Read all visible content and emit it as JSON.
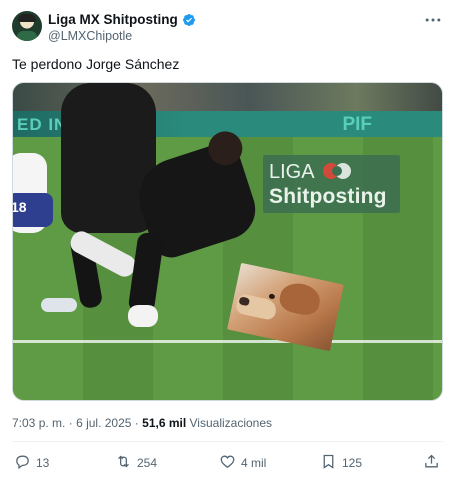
{
  "author": {
    "display_name": "Liga MX Shitposting",
    "handle": "@LMXChipotle",
    "verified": true
  },
  "tweet": {
    "text": "Te perdono Jorge Sánchez"
  },
  "media": {
    "board_text_left": "ED IN ER",
    "board_text_right": "PIF",
    "player_number": "18",
    "logo_line1": "LIGA",
    "logo_line2": "Shitposting"
  },
  "meta": {
    "time": "7:03 p. m.",
    "separator": "·",
    "date": "6 jul. 2025",
    "separator2": "·",
    "views_count": "51,6 mil",
    "views_label": "Visualizaciones"
  },
  "actions": {
    "replies": "13",
    "retweets": "254",
    "likes": "4 mil",
    "bookmarks": "125"
  },
  "icons": {
    "verified": "verified-badge-icon",
    "more": "more-options-icon",
    "reply": "reply-icon",
    "retweet": "retweet-icon",
    "like": "heart-icon",
    "bookmark": "bookmark-icon",
    "share": "share-icon"
  },
  "colors": {
    "verified_blue": "#1d9bf0",
    "secondary_text": "#536471",
    "primary_text": "#0f1419"
  }
}
